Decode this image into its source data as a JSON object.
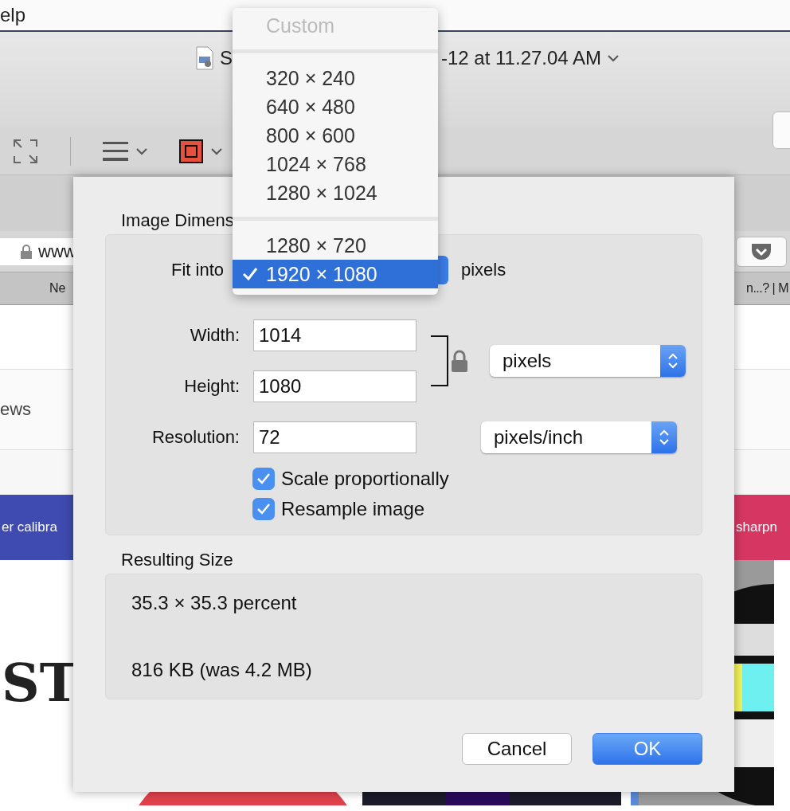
{
  "menubar": {
    "menu_fragment": "elp"
  },
  "document": {
    "title_start": "S",
    "title_end": "-12 at 11.27.04 AM"
  },
  "browser": {
    "address_fragment": "www",
    "bookmarks": [
      "Ne",
      "n...? | M"
    ]
  },
  "webpage": {
    "nav_fragment": "ews",
    "heading_fragment": "ST",
    "banners": [
      {
        "text": "er calibra",
        "color": "#3f4bb0"
      },
      {
        "text": "sharpn",
        "color": "#d63762"
      }
    ]
  },
  "dialog": {
    "section_title": "Image Dimens",
    "fit_label": "Fit into",
    "fit_unit": "pixels",
    "fields": [
      {
        "label": "Width:",
        "value": "1014"
      },
      {
        "label": "Height:",
        "value": "1080"
      },
      {
        "label": "Resolution:",
        "value": "72"
      }
    ],
    "size_unit": "pixels",
    "resolution_unit": "pixels/inch",
    "locked": true,
    "checkboxes": [
      {
        "label": "Scale proportionally",
        "checked": true
      },
      {
        "label": "Resample image",
        "checked": true
      }
    ],
    "result_title": "Resulting Size",
    "result_lines": [
      "35.3 × 35.3 percent",
      "816 KB (was 4.2 MB)"
    ],
    "buttons": [
      {
        "label": "Cancel",
        "kind": "default"
      },
      {
        "label": "OK",
        "kind": "primary"
      }
    ]
  },
  "menu": {
    "items": [
      {
        "kind": "item",
        "label": "Custom",
        "disabled": true,
        "selected": false
      },
      {
        "kind": "separator"
      },
      {
        "kind": "item",
        "label": "320 × 240",
        "disabled": false,
        "selected": false
      },
      {
        "kind": "item",
        "label": "640 × 480",
        "disabled": false,
        "selected": false
      },
      {
        "kind": "item",
        "label": "800 × 600",
        "disabled": false,
        "selected": false
      },
      {
        "kind": "item",
        "label": "1024 × 768",
        "disabled": false,
        "selected": false
      },
      {
        "kind": "item",
        "label": "1280 × 1024",
        "disabled": false,
        "selected": false
      },
      {
        "kind": "separator"
      },
      {
        "kind": "item",
        "label": "1280 × 720",
        "disabled": false,
        "selected": false
      },
      {
        "kind": "item",
        "label": "1920 × 1080",
        "disabled": false,
        "selected": true
      }
    ]
  }
}
